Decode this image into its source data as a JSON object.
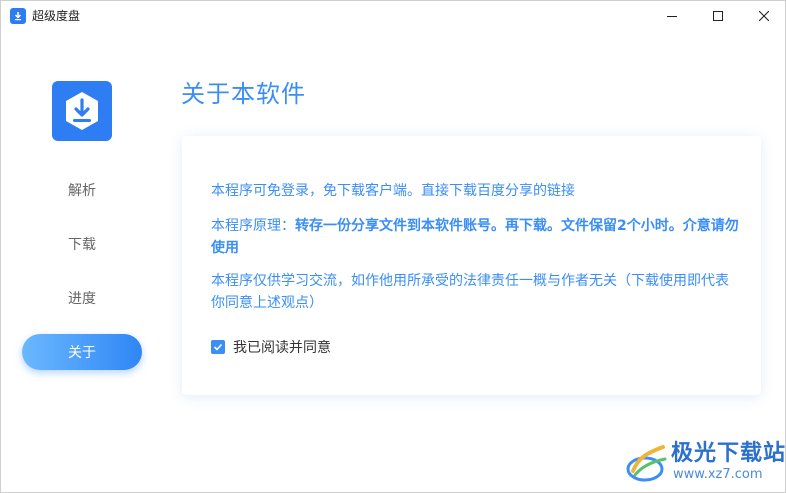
{
  "window": {
    "title": "超级度盘",
    "controls": {
      "minimize": "—",
      "maximize": "☐",
      "close": "✕"
    }
  },
  "sidebar": {
    "items": [
      {
        "label": "解析",
        "active": false
      },
      {
        "label": "下载",
        "active": false
      },
      {
        "label": "进度",
        "active": false
      },
      {
        "label": "关于",
        "active": true
      }
    ]
  },
  "main": {
    "title": "关于本软件",
    "paragraphs": {
      "p1": "本程序可免登录，免下载客户端。直接下载百度分享的链接",
      "p2_prefix": "本程序原理：",
      "p2_bold": "转存一份分享文件到本软件账号。再下载。文件保留2个小时。介意请勿使用",
      "p3": "本程序仅供学习交流，如作他用所承受的法律责任一概与作者无关（下载使用即代表你同意上述观点）"
    },
    "agree": {
      "label": "我已阅读并同意",
      "checked": true
    }
  },
  "watermark": {
    "title": "极光下载站",
    "url": "www.xz7.com"
  },
  "colors": {
    "accent": "#3a8ef5",
    "logo_bg": "#2e7df2",
    "nav_active_start": "#6bb8ff",
    "nav_active_end": "#2f86f5"
  }
}
